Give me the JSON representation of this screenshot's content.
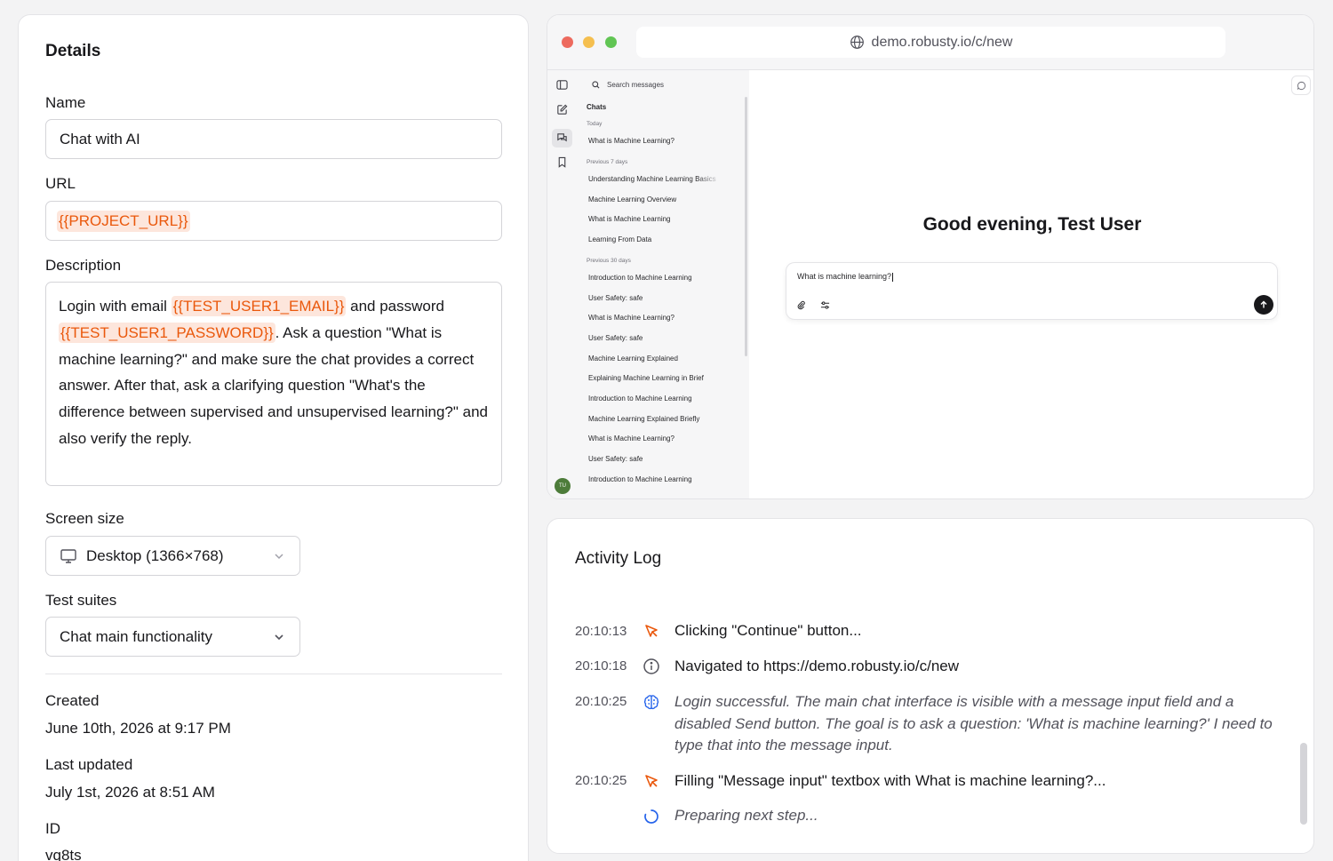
{
  "details": {
    "title": "Details",
    "name_label": "Name",
    "name_value": "Chat with AI",
    "url_label": "URL",
    "url_value": "{{PROJECT_URL}}",
    "description_label": "Description",
    "description": {
      "part1": "Login with email ",
      "token1": "{{TEST_USER1_EMAIL}}",
      "part2": " and password ",
      "token2": "{{TEST_USER1_PASSWORD}}",
      "part3": ". Ask a question \"What is machine learning?\" and make sure the chat provides a correct answer. After that, ask a clarifying question \"What's the difference between supervised and unsupervised learning?\" and also verify the reply."
    },
    "screen_size_label": "Screen size",
    "screen_size_value": "Desktop (1366×768)",
    "test_suites_label": "Test suites",
    "test_suites_value": "Chat main functionality",
    "created_label": "Created",
    "created_value": "June 10th, 2026 at 9:17 PM",
    "updated_label": "Last updated",
    "updated_value": "July 1st, 2026 at 8:51 AM",
    "id_label": "ID",
    "id_value": "vq8ts"
  },
  "browser": {
    "address": "demo.robusty.io/c/new",
    "traffic_lights": [
      "#ed6a5e",
      "#f5bf4f",
      "#61c554"
    ],
    "avatar_initials": "TU",
    "search_placeholder": "Search messages",
    "chats_heading": "Chats",
    "groups": [
      {
        "label": "Today",
        "items": [
          "What is Machine Learning?"
        ]
      },
      {
        "label": "Previous 7 days",
        "items": [
          "Understanding Machine Learning Basics",
          "Machine Learning Overview",
          "What is Machine Learning",
          "Learning From Data"
        ]
      },
      {
        "label": "Previous 30 days",
        "items": [
          "Introduction to Machine Learning",
          "User Safety: safe",
          "What is Machine Learning?",
          "User Safety: safe",
          "Machine Learning Explained",
          "Explaining Machine Learning in Brief",
          "Introduction to Machine Learning",
          "Machine Learning Explained Briefly",
          "What is Machine Learning?",
          "User Safety: safe",
          "Introduction to Machine Learning"
        ]
      }
    ],
    "greeting": "Good evening, Test User",
    "composer_text": "What is machine learning?"
  },
  "activity": {
    "title": "Activity Log",
    "entries": [
      {
        "time": "20:10:13",
        "icon": "cursor-click-icon",
        "text": "Clicking \"Continue\" button..."
      },
      {
        "time": "20:10:18",
        "icon": "info-icon",
        "text": "Navigated to https://demo.robusty.io/c/new"
      },
      {
        "time": "20:10:25",
        "icon": "brain-icon",
        "text": "Login successful. The main chat interface is visible with a message input field and a disabled Send button. The goal is to ask a question: 'What is machine learning?' I need to type that into the message input."
      },
      {
        "time": "20:10:25",
        "icon": "cursor-click-icon",
        "text": "Filling \"Message input\" textbox with What is machine learning?..."
      },
      {
        "time": "",
        "icon": "spinner-icon",
        "text": "Preparing next step..."
      }
    ]
  },
  "colors": {
    "accent_orange": "#ea580c",
    "token_bg": "#fde6dc",
    "info_blue": "#2563eb"
  }
}
